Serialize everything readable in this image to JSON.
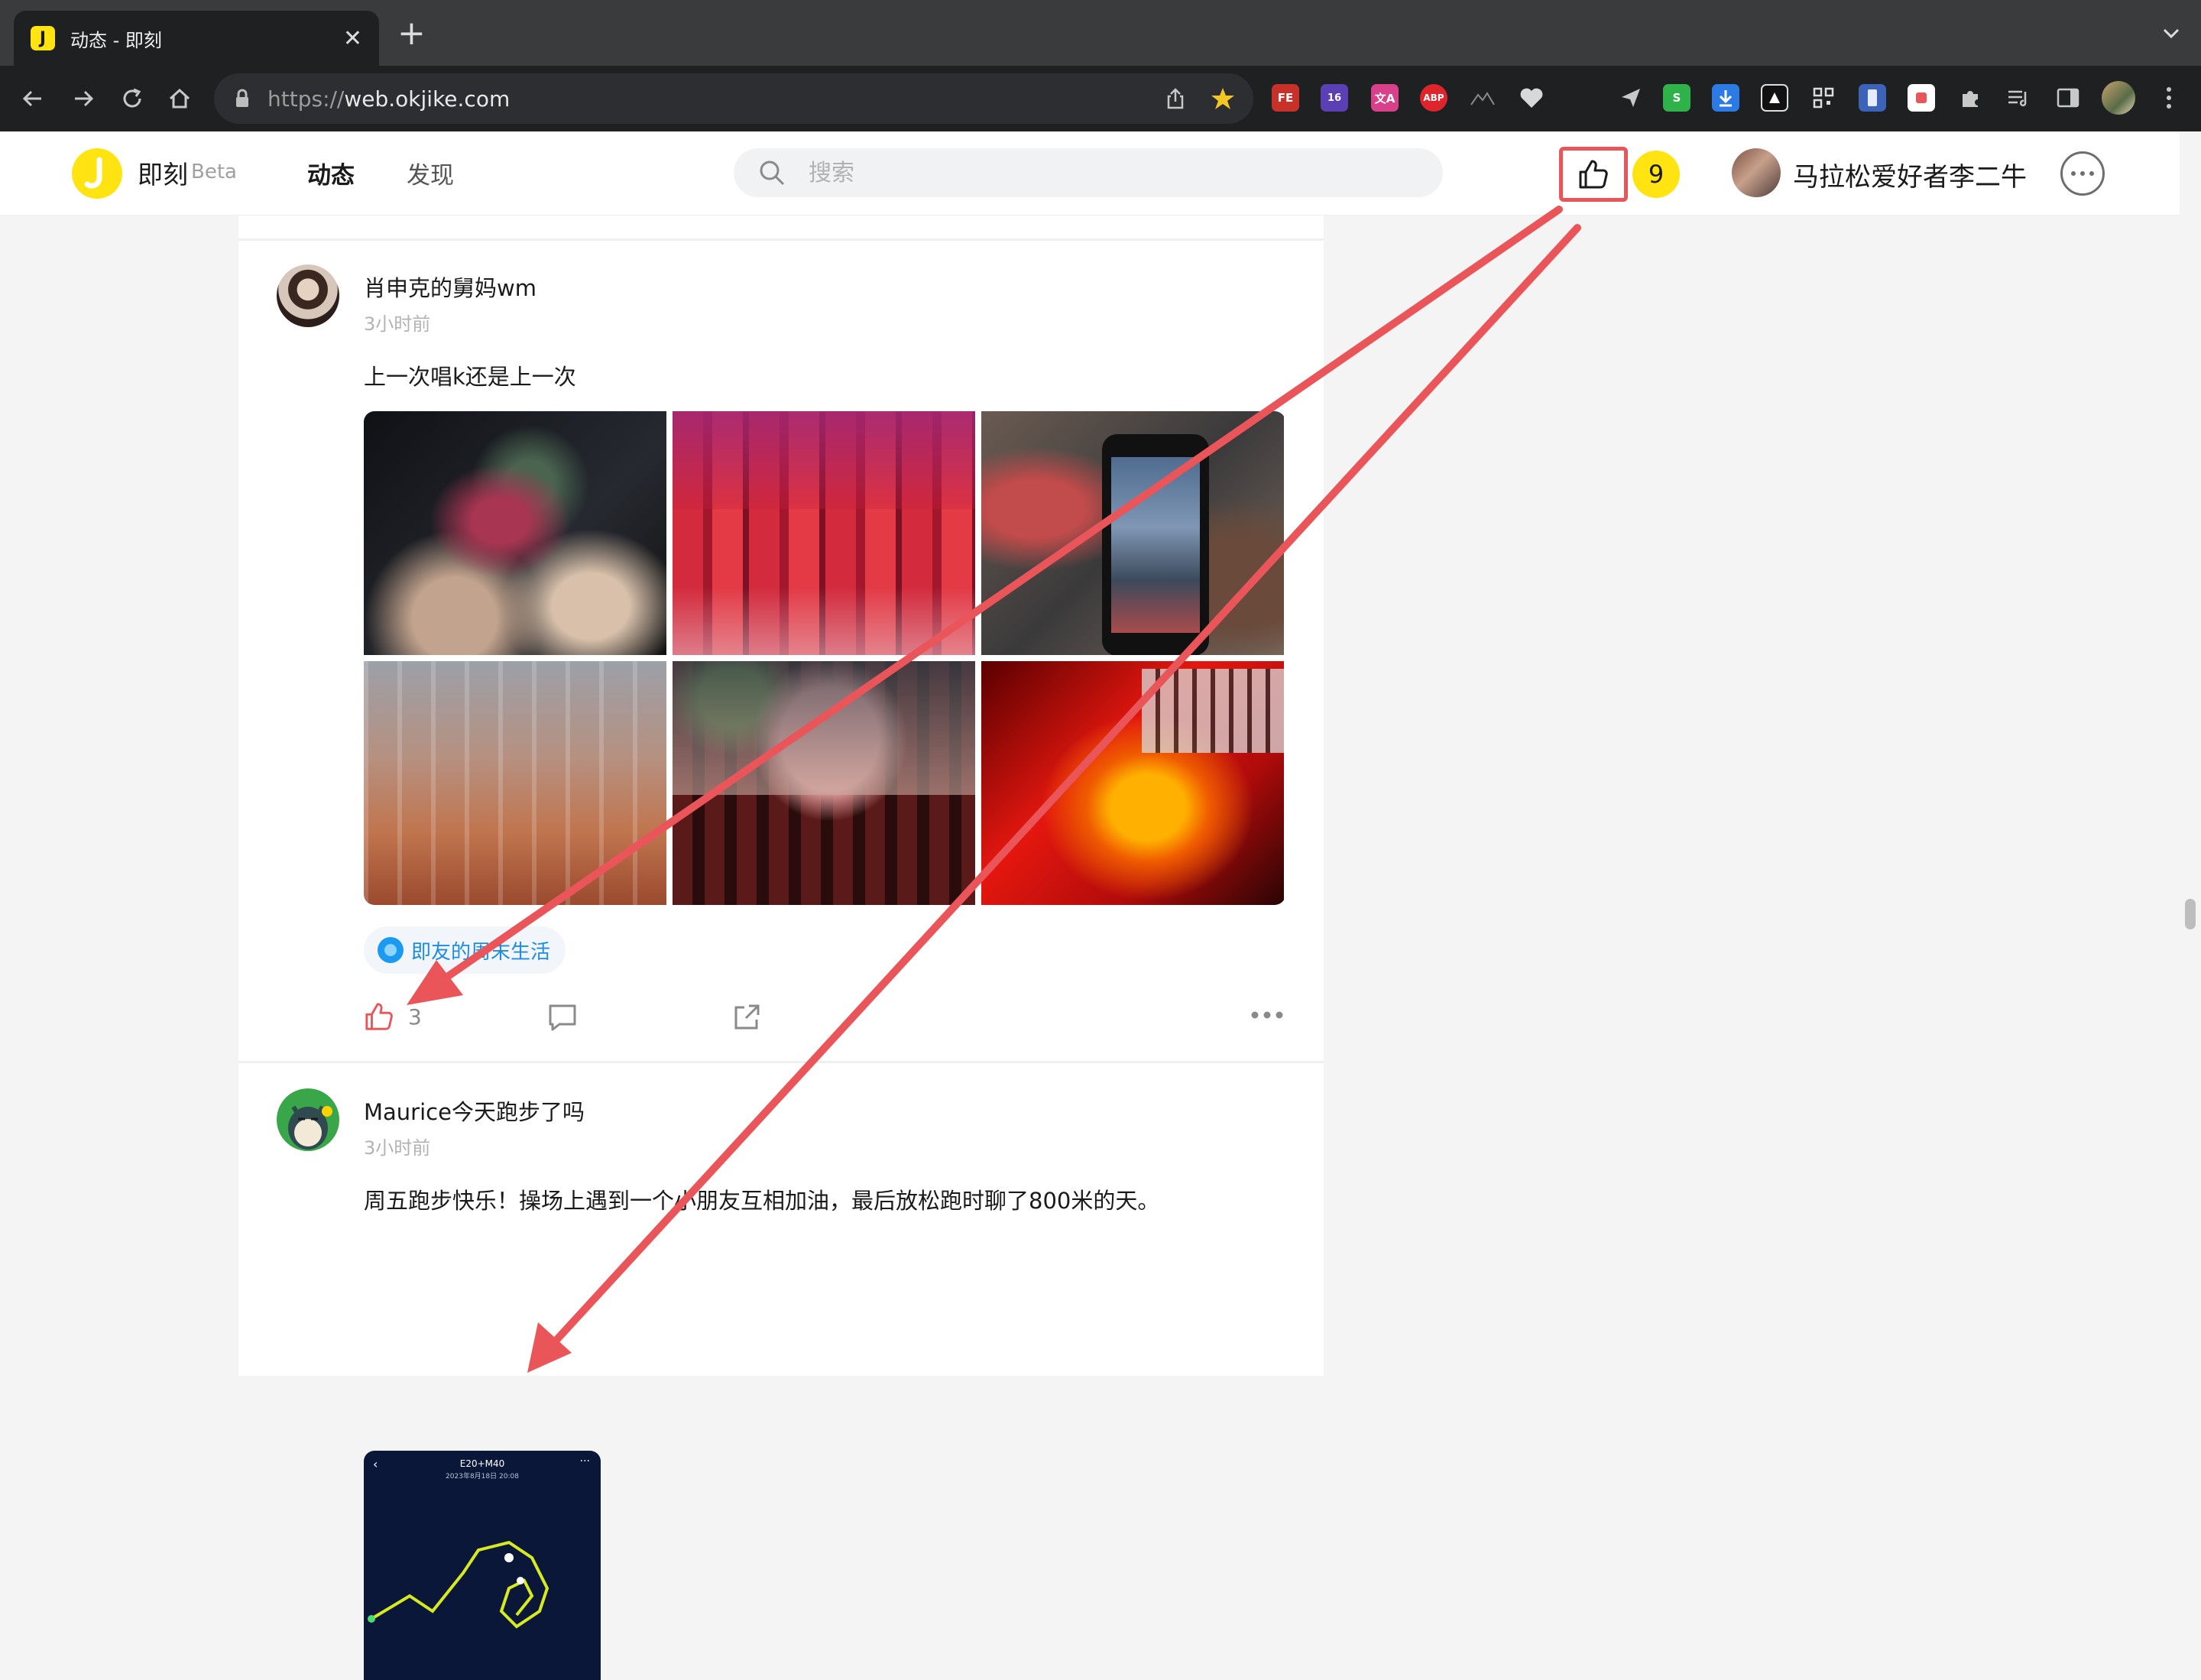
{
  "browser": {
    "tab_title": "动态 - 即刻",
    "tab_favicon": "J",
    "url_scheme": "https://",
    "url_host": "web.okjike.com",
    "extensions": [
      "FE",
      "16",
      "文A",
      "ABP",
      "S"
    ]
  },
  "header": {
    "brand": "即刻",
    "beta": "Beta",
    "nav": [
      "动态",
      "发现"
    ],
    "search_placeholder": "搜索",
    "like_count": "9",
    "username": "马拉松爱好者李二牛"
  },
  "posts": [
    {
      "author": "肖申克的舅妈wm",
      "time": "3小时前",
      "content": "上一次唱k还是上一次",
      "images": [
        "bottles-toast",
        "red-bottles-row",
        "phone-photo",
        "glasses-row",
        "food-table",
        "red-glass-ktv"
      ],
      "topic": "即友的周末生活",
      "likes": "3"
    },
    {
      "author": "Maurice今天跑步了吗",
      "time": "3小时前",
      "content": "周五跑步快乐！操场上遇到一个小朋友互相加油，最后放松跑时聊了800米的天。",
      "screenshot_title": "E20+M40",
      "screenshot_date": "2023年8月18日 20:08"
    }
  ],
  "colors": {
    "accent_yellow": "#ffe411",
    "annotation_red": "#e95559",
    "topic_blue": "#1c8ce4"
  }
}
